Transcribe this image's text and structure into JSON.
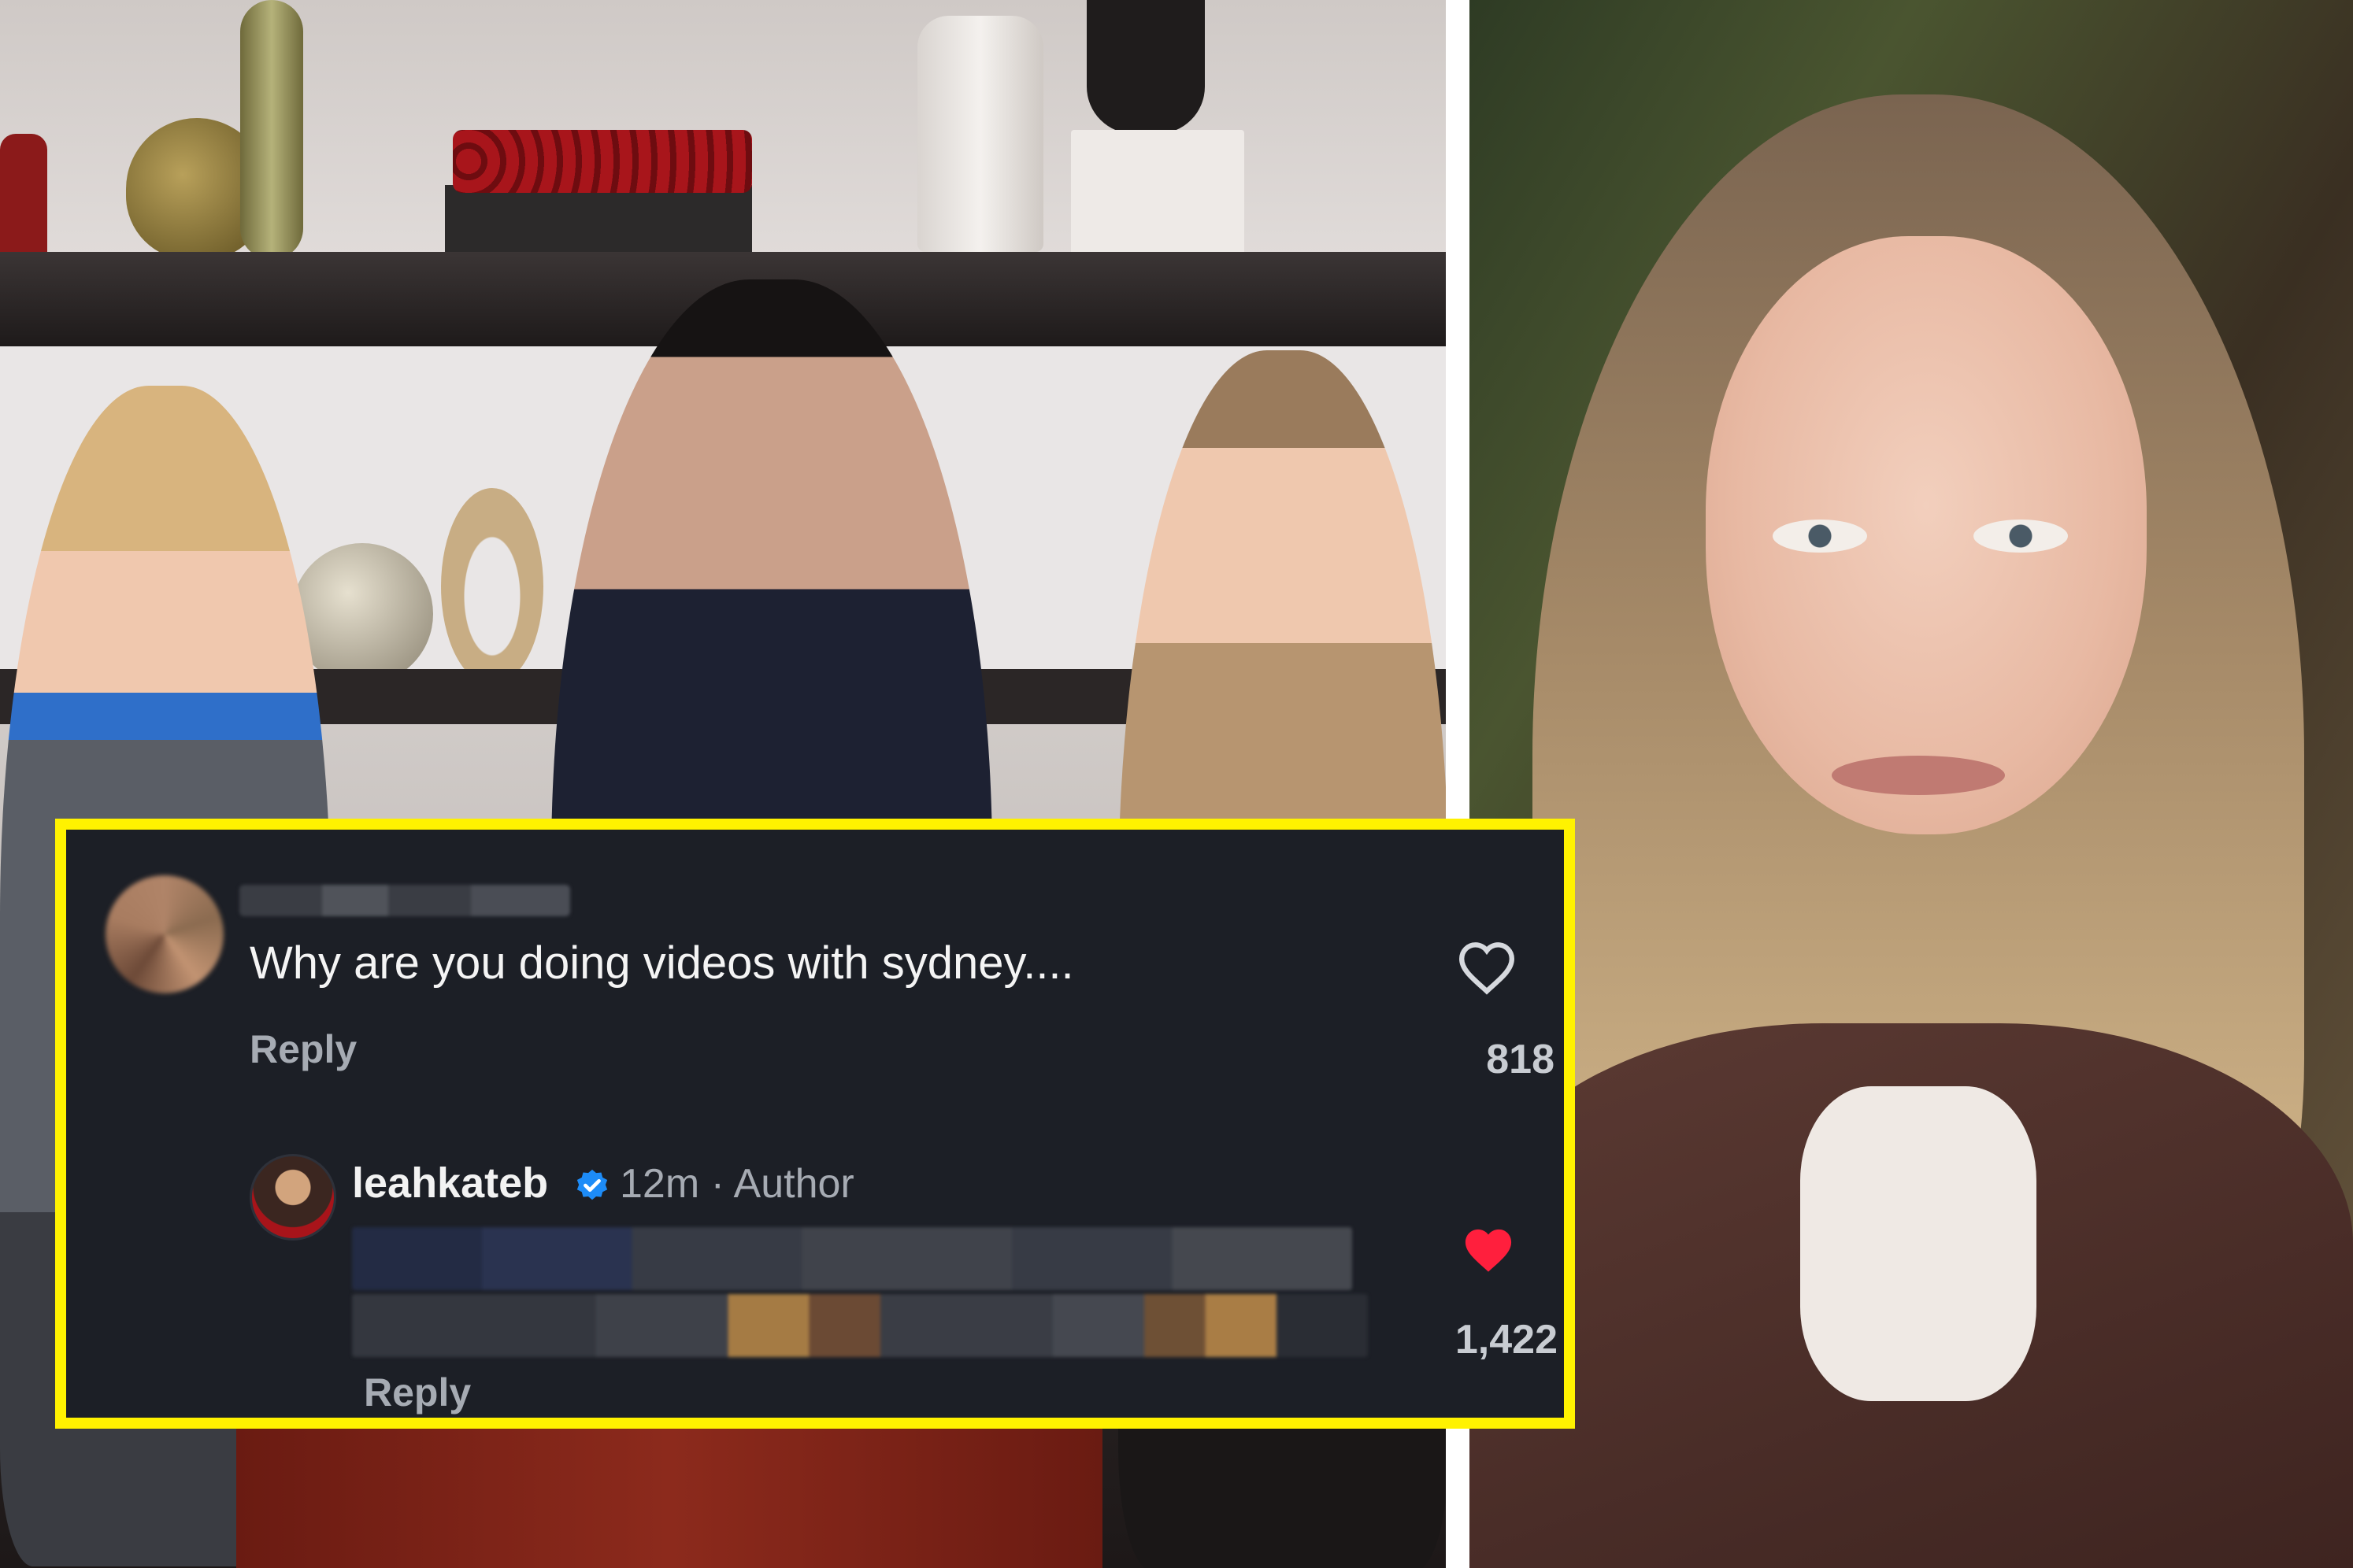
{
  "comment": {
    "text": "Why are you doing videos with sydney....",
    "reply_label": "Reply",
    "likes": "818",
    "liked": false
  },
  "author_reply": {
    "username": "leahkateb",
    "verified": true,
    "time": "12m",
    "separator": "·",
    "role": "Author",
    "reply_label": "Reply",
    "likes": "1,422",
    "liked": true
  },
  "colors": {
    "highlight_border": "#fff200",
    "card_background": "#1c1f26",
    "verified_badge": "#1d8cf8",
    "liked_heart": "#ff1f3d",
    "muted_text": "#a6abb3"
  },
  "icons": [
    "heart-outline-icon",
    "heart-filled-icon",
    "verified-badge-icon"
  ]
}
